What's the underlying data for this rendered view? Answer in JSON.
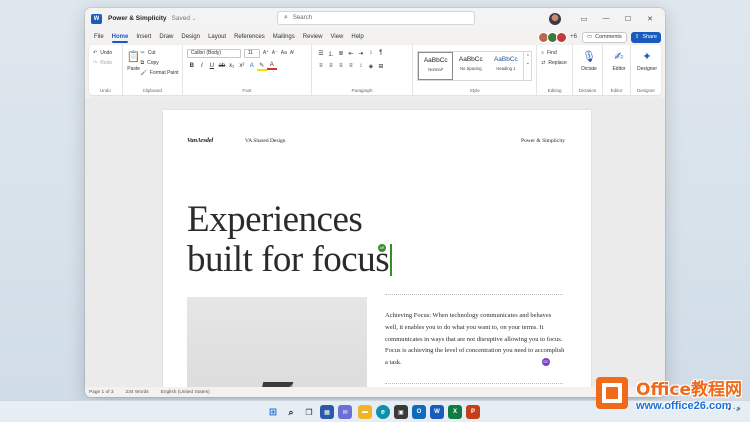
{
  "titlebar": {
    "doc_title": "Power & Simplicity",
    "status": "Saved",
    "search_placeholder": "Search"
  },
  "tabs": [
    "File",
    "Home",
    "Insert",
    "Draw",
    "Design",
    "Layout",
    "References",
    "Mailings",
    "Review",
    "View",
    "Help"
  ],
  "active_tab": "Home",
  "collab": {
    "extra_count": "+6",
    "comments_label": "Comments",
    "share_label": "Share"
  },
  "ribbon": {
    "undo": {
      "undo_label": "Undo",
      "redo_label": "Redo",
      "group": "Undo"
    },
    "clipboard": {
      "paste_label": "Paste",
      "cut_label": "Cut",
      "copy_label": "Copy",
      "format_painter_label": "Format Paint",
      "group": "Clipboard"
    },
    "font": {
      "font_name": "Calibri (Body)",
      "font_size": "11",
      "group": "Font"
    },
    "paragraph": {
      "group": "Paragraph"
    },
    "styles": {
      "items": [
        {
          "sample": "AaBbCc",
          "name": "Normal*"
        },
        {
          "sample": "AaBbCc",
          "name": "No Spacing"
        },
        {
          "sample": "AaBbCc",
          "name": "Heading 1"
        }
      ],
      "group": "Style"
    },
    "editing": {
      "find_label": "Find",
      "replace_label": "Replace",
      "group": "Editing"
    },
    "dictation": {
      "label": "Dictate",
      "group": "Dictation"
    },
    "editor": {
      "label": "Editor",
      "group": "Editor"
    },
    "designer": {
      "label": "Designer",
      "group": "Designer"
    }
  },
  "page": {
    "brand": "VanArsdel",
    "header_mid": "VA Shared Design",
    "header_right": "Power & Simplicity",
    "headline_line1": "Experiences",
    "headline_line2": "built for focus",
    "body": "Achieving Focus: When technology communicates and behaves well, it enables you to do what you want to, on your terms. It communicates in ways that are not disruptive allowing you to focus. Focus is achieving the level of concentration you need to accomplish a task."
  },
  "presence": {
    "green_initials": "AR",
    "purple_initials": "DC"
  },
  "statusbar": {
    "page": "Page 1 of 3",
    "words": "234 Words",
    "language": "English (United States)"
  },
  "watermark": {
    "line1": "Office教程网",
    "line2": "www.office26.com"
  },
  "colors": {
    "word_blue": "#185abd",
    "cursor_green": "#3a8a2e",
    "watermark_orange": "#f06a1b"
  }
}
